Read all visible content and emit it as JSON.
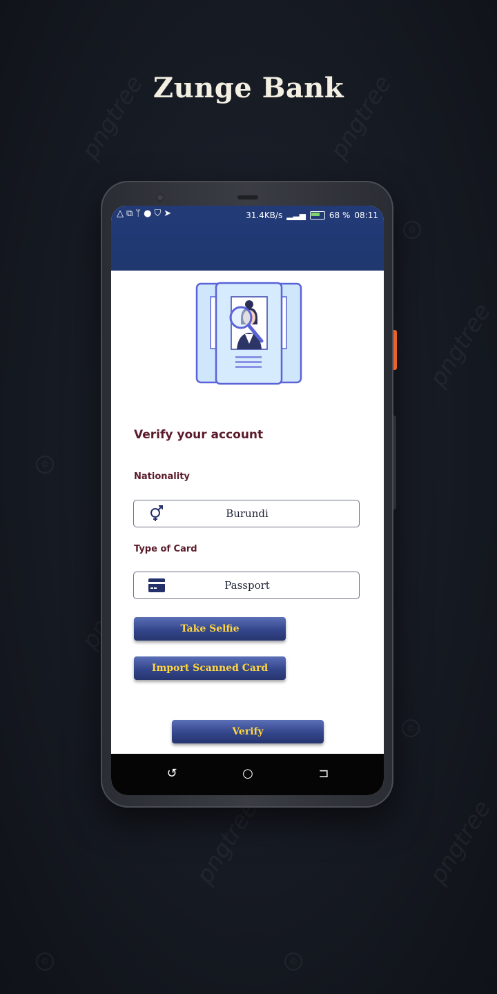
{
  "brand": {
    "title": "Zunge Bank"
  },
  "status_bar": {
    "network_speed": "31.4KB/s",
    "battery": "68 %",
    "time": "08:11"
  },
  "form": {
    "title": "Verify your account",
    "nationality": {
      "label": "Nationality",
      "value": "Burundi",
      "icon": "gender-icon"
    },
    "card_type": {
      "label": "Type of Card",
      "value": "Passport",
      "icon": "credit-card-icon"
    },
    "buttons": {
      "take_selfie": "Take Selfie",
      "import_card": "Import Scanned Card",
      "verify": "Verify"
    }
  },
  "colors": {
    "header": "#223a77",
    "button_text": "#ffd640",
    "label": "#5a1a2a"
  }
}
